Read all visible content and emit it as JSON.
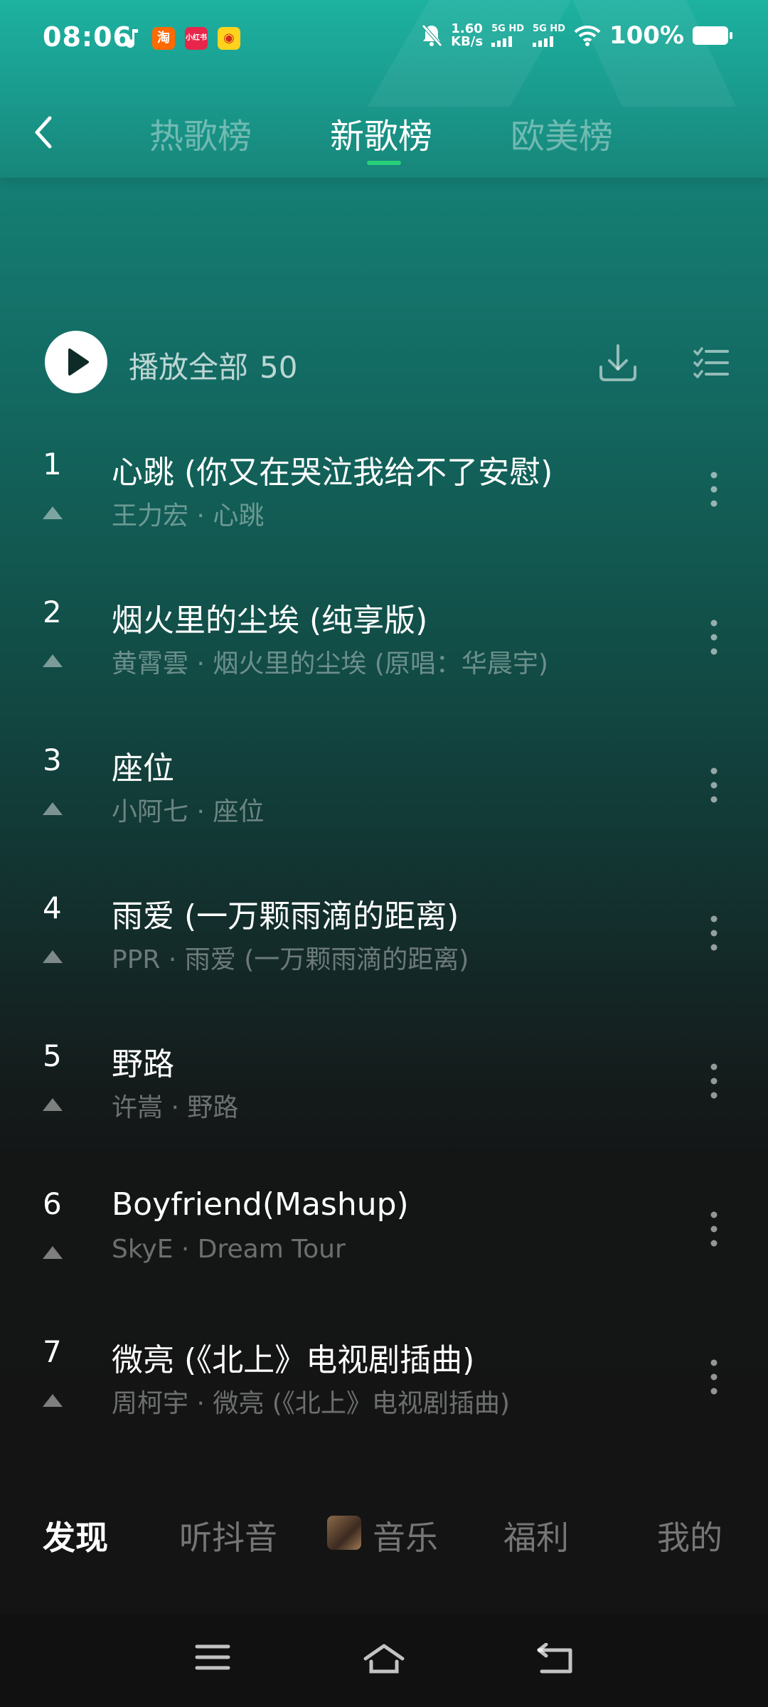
{
  "status_bar": {
    "time": "08:06",
    "app_icons": [
      "music-note-icon",
      "taobao-icon",
      "news-icon",
      "weibo-icon"
    ],
    "net_speed_value": "1.60",
    "net_speed_unit": "KB/s",
    "sim1_label": "5G HD",
    "sim2_label": "5G HD",
    "battery": "100%"
  },
  "header": {
    "tabs": [
      {
        "label": "热歌榜"
      },
      {
        "label": "新歌榜"
      },
      {
        "label": "欧美榜"
      }
    ],
    "active_tab": 1
  },
  "play_all": {
    "label": "播放全部",
    "count": "50"
  },
  "songs": [
    {
      "rank": "1",
      "title": "心跳 (你又在哭泣我给不了安慰)",
      "subtitle": "王力宏 · 心跳",
      "trend": "up"
    },
    {
      "rank": "2",
      "title": "烟火里的尘埃 (纯享版)",
      "subtitle": "黄霄雲 · 烟火里的尘埃 (原唱：华晨宇)",
      "trend": "up"
    },
    {
      "rank": "3",
      "title": "座位",
      "subtitle": "小阿七 · 座位",
      "trend": "up"
    },
    {
      "rank": "4",
      "title": "雨爱 (一万颗雨滴的距离)",
      "subtitle": "PPR · 雨爱 (一万颗雨滴的距离)",
      "trend": "up"
    },
    {
      "rank": "5",
      "title": "野路",
      "subtitle": "许嵩 · 野路",
      "trend": "up"
    },
    {
      "rank": "6",
      "title": "Boyfriend(Mashup)",
      "subtitle": "SkyE · Dream Tour",
      "trend": "up"
    },
    {
      "rank": "7",
      "title": "微亮 (《北上》电视剧插曲)",
      "subtitle": "周柯宇 · 微亮 (《北上》电视剧插曲)",
      "trend": "up"
    }
  ],
  "bottom_nav": {
    "items": [
      {
        "label": "发现"
      },
      {
        "label": "听抖音"
      },
      {
        "label": "音乐"
      },
      {
        "label": "福利"
      },
      {
        "label": "我的"
      }
    ],
    "active": 0
  },
  "colors": {
    "accent": "#26d07a",
    "header_teal": "#1db2a1",
    "background_dark": "#141414"
  }
}
